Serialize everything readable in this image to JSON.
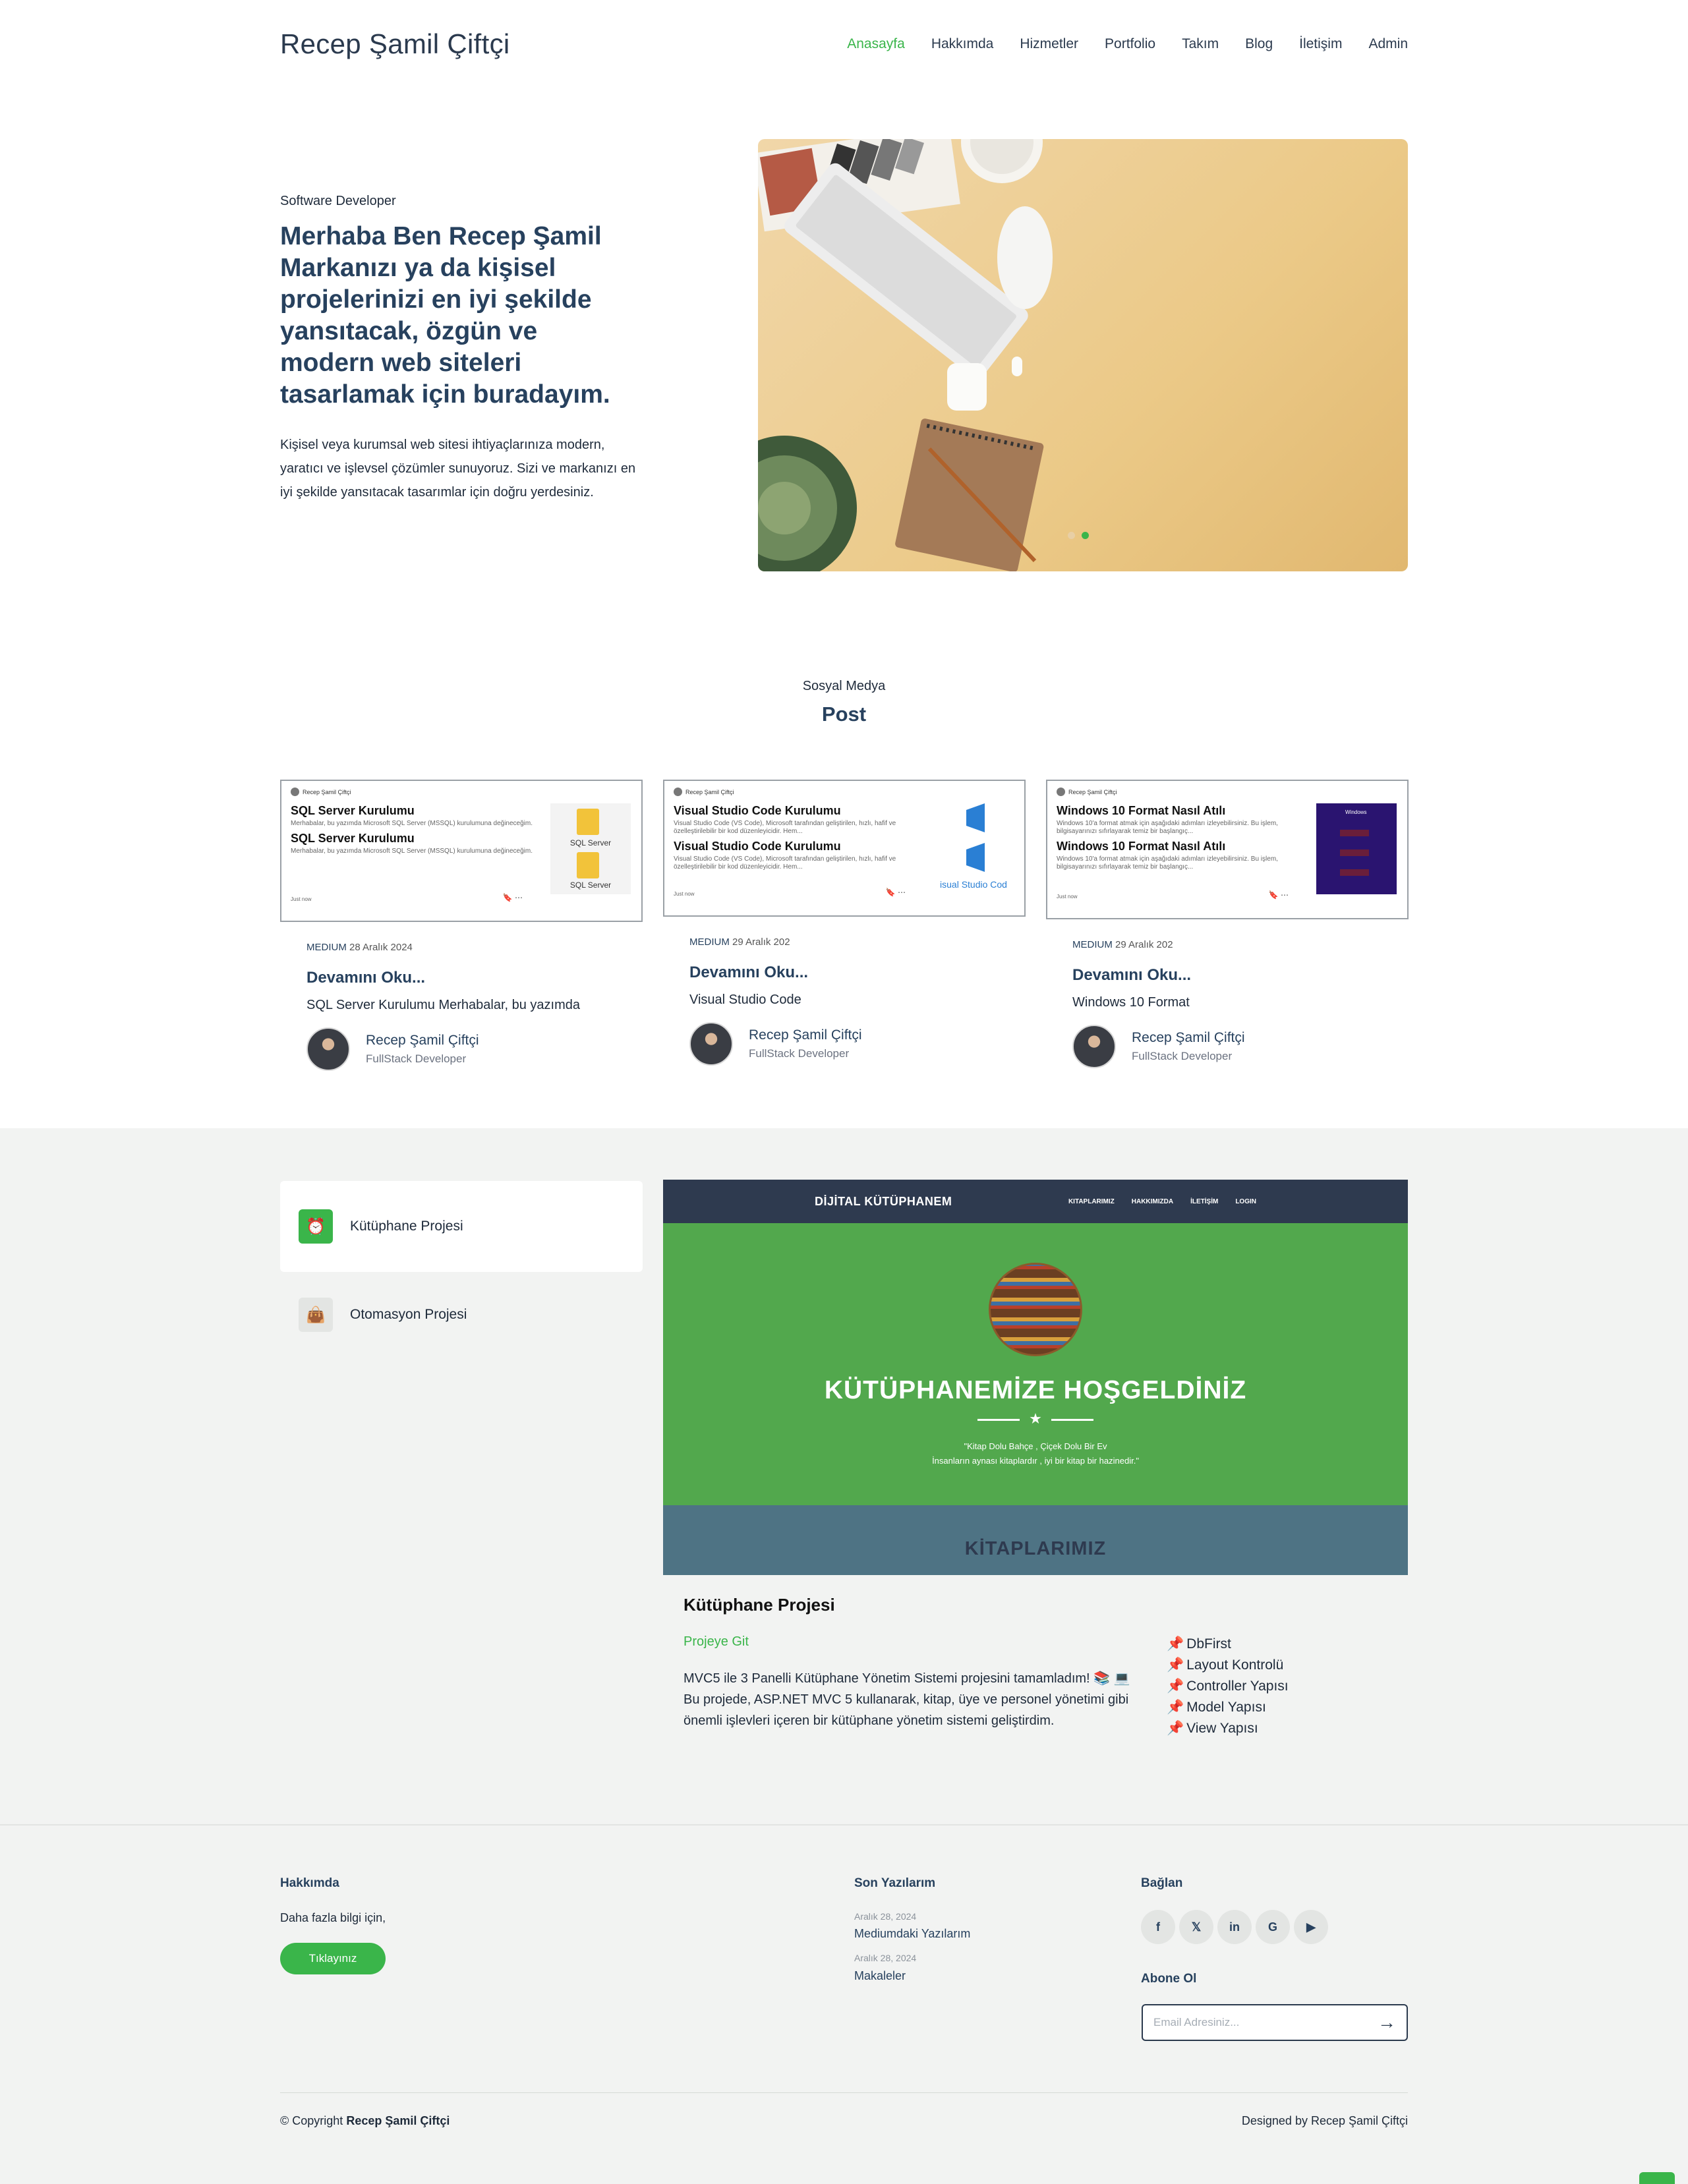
{
  "header": {
    "brand": "Recep Şamil Çiftçi",
    "nav": [
      {
        "label": "Anasayfa",
        "active": true
      },
      {
        "label": "Hakkımda"
      },
      {
        "label": "Hizmetler"
      },
      {
        "label": "Portfolio"
      },
      {
        "label": "Takım"
      },
      {
        "label": "Blog"
      },
      {
        "label": "İletişim"
      },
      {
        "label": "Admin"
      }
    ]
  },
  "hero": {
    "kicker": "Software Developer",
    "title": "Merhaba Ben Recep Şamil Markanızı ya da kişisel projelerinizi en iyi şekilde yansıtacak, özgün ve modern web siteleri tasarlamak için buradayım.",
    "description": "Kişisel veya kurumsal web sitesi ihtiyaçlarınıza modern, yaratıcı ve işlevsel çözümler sunuyoruz. Sizi ve markanızı en iyi şekilde yansıtacak tasarımlar için doğru yerdesiniz.",
    "image_icon": "desk-workspace-photo",
    "slider_active_index": 2
  },
  "social": {
    "kicker": "Sosyal Medya",
    "title": "Post",
    "cards": [
      {
        "shot_author": "Recep Şamil Çiftçi",
        "shot_heading": "SQL Server Kurulumu",
        "shot_text": "Merhabalar, bu yazımda Microsoft SQL Server (MSSQL) kurulumuna değineceğim.",
        "shot_foot": "Just now",
        "thumb_label": "SQL Server",
        "source": "MEDIUM",
        "date": "28 Aralık 2024",
        "link": "Devamını Oku...",
        "subtitle": "SQL Server Kurulumu Merhabalar, bu yazımda",
        "author_name": "Recep Şamil Çiftçi",
        "author_role": "FullStack Developer"
      },
      {
        "shot_author": "Recep Şamil Çiftçi",
        "shot_heading": "Visual Studio Code Kurulumu",
        "shot_text": "Visual Studio Code (VS Code), Microsoft tarafından geliştirilen, hızlı, hafif ve özelleştirilebilir bir kod düzenleyicidir. Hem...",
        "shot_foot": "Just now",
        "thumb_label": "isual Studio Cod",
        "source": "MEDIUM",
        "date": "29 Aralık 202",
        "link": "Devamını Oku...",
        "subtitle": "Visual Studio Code",
        "author_name": "Recep Şamil Çiftçi",
        "author_role": "FullStack Developer"
      },
      {
        "shot_author": "Recep Şamil Çiftçi",
        "shot_heading": "Windows 10 Format Nasıl Atılı",
        "shot_text": "Windows 10'a format atmak için aşağıdaki adımları izleyebilirsiniz. Bu işlem, bilgisayarınızı sıfırlayarak temiz bir başlangıç...",
        "shot_foot": "Just now",
        "thumb_label": "Windows",
        "source": "MEDIUM",
        "date": "29 Aralık 202",
        "link": "Devamını Oku...",
        "subtitle": "Windows 10 Format",
        "author_name": "Recep Şamil Çiftçi",
        "author_role": "FullStack Developer"
      }
    ]
  },
  "projects": {
    "tabs": [
      {
        "label": "Kütüphane Projesi",
        "icon": "alarm-clock-icon",
        "active": true
      },
      {
        "label": "Otomasyon Projesi",
        "icon": "shopping-bag-icon",
        "active": false
      }
    ],
    "screenshot": {
      "brand": "DİJİTAL KÜTÜPHANEM",
      "links": [
        "KITAPLARIMIZ",
        "HAKKIMIZDA",
        "İLETİŞİM",
        "LOGIN"
      ],
      "title": "KÜTÜPHANEMİZE HOŞGELDİNİZ",
      "quote_line1": "\"Kitap Dolu Bahçe , Çiçek Dolu Bir Ev",
      "quote_line2": "İnsanların aynası kitaplardır , iyi bir kitap bir hazinedir.\"",
      "section": "KİTAPLARIMIZ"
    },
    "title": "Kütüphane Projesi",
    "link": "Projeye Git",
    "description": "MVC5 ile 3 Panelli Kütüphane Yönetim Sistemi projesini tamamladım! 📚 💻 Bu projede, ASP.NET MVC 5 kullanarak, kitap, üye ve personel yönetimi gibi önemli işlevleri içeren bir kütüphane yönetim sistemi geliştirdim.",
    "features": [
      "DbFirst",
      "Layout Kontrolü",
      "Controller Yapısı",
      "Model Yapısı",
      "View Yapısı"
    ]
  },
  "footer": {
    "about_heading": "Hakkımda",
    "about_text": "Daha fazla bilgi için,",
    "about_button": "Tıklayınız",
    "posts_heading": "Son Yazılarım",
    "posts": [
      {
        "date": "Aralık 28, 2024",
        "title": "Mediumdaki Yazılarım"
      },
      {
        "date": "Aralık 28, 2024",
        "title": "Makaleler"
      }
    ],
    "connect_heading": "Bağlan",
    "socials": [
      {
        "icon": "facebook-icon",
        "glyph": "f"
      },
      {
        "icon": "x-icon",
        "glyph": "𝕏"
      },
      {
        "icon": "linkedin-icon",
        "glyph": "in"
      },
      {
        "icon": "google-icon",
        "glyph": "G"
      },
      {
        "icon": "google-play-icon",
        "glyph": "▶"
      }
    ],
    "subscribe_heading": "Abone Ol",
    "subscribe_placeholder": "Email Adresiniz...",
    "copyright_prefix": "© Copyright",
    "copyright_name": "Recep Şamil Çiftçi",
    "designed_by": "Designed by Recep Şamil Çiftçi"
  },
  "colors": {
    "accent": "#3ab54a",
    "heading": "#27415e",
    "section_bg": "#f2f3f2"
  }
}
